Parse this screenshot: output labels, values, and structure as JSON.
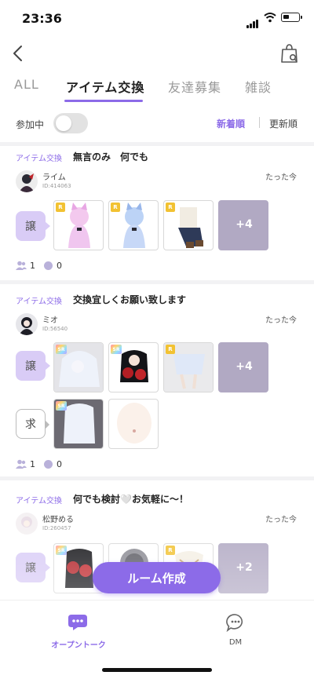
{
  "status_bar": {
    "time": "23:36"
  },
  "tabs": [
    {
      "label": "ALL"
    },
    {
      "label": "アイテム交換"
    },
    {
      "label": "友達募集"
    },
    {
      "label": "雑談"
    }
  ],
  "filter": {
    "participating_label": "参加中",
    "sort_new": "新着順",
    "sort_updated": "更新順"
  },
  "posts": [
    {
      "category": "アイテム交換",
      "title": "無言のみ　何でも",
      "user": "ライム",
      "user_id": "ID:414063",
      "time": "たった今",
      "give_label": "譲",
      "give_items": [
        {
          "rarity": "R"
        },
        {
          "rarity": "R"
        },
        {
          "rarity": "R"
        }
      ],
      "give_more": "+4",
      "members": "1",
      "comments": "0"
    },
    {
      "category": "アイテム交換",
      "title": "交換宜しくお願い致します",
      "user": "ミオ",
      "user_id": "ID:56540",
      "time": "たった今",
      "give_label": "譲",
      "give_items": [
        {
          "rarity": "SR"
        },
        {
          "rarity": "SR"
        },
        {
          "rarity": "R"
        }
      ],
      "give_more": "+4",
      "want_label": "求",
      "want_items": [
        {
          "rarity": "SR"
        },
        {
          "rarity": ""
        }
      ],
      "members": "1",
      "comments": "0"
    },
    {
      "category": "アイテム交換",
      "title": "何でも検討🤍お気軽に〜！",
      "user": "松野める",
      "user_id": "ID:260457",
      "time": "たった今",
      "give_label": "譲",
      "give_items": [
        {
          "rarity": "SR"
        },
        {
          "rarity": ""
        },
        {
          "rarity": "R"
        }
      ],
      "give_more": "+2"
    }
  ],
  "fab": {
    "label": "ルーム作成"
  },
  "bottom_nav": [
    {
      "label": "オープントーク"
    },
    {
      "label": "DM"
    }
  ],
  "colors": {
    "accent": "#8c6be8",
    "give_bg": "#d9ccf6",
    "more_tile": "#b1a9c3"
  }
}
